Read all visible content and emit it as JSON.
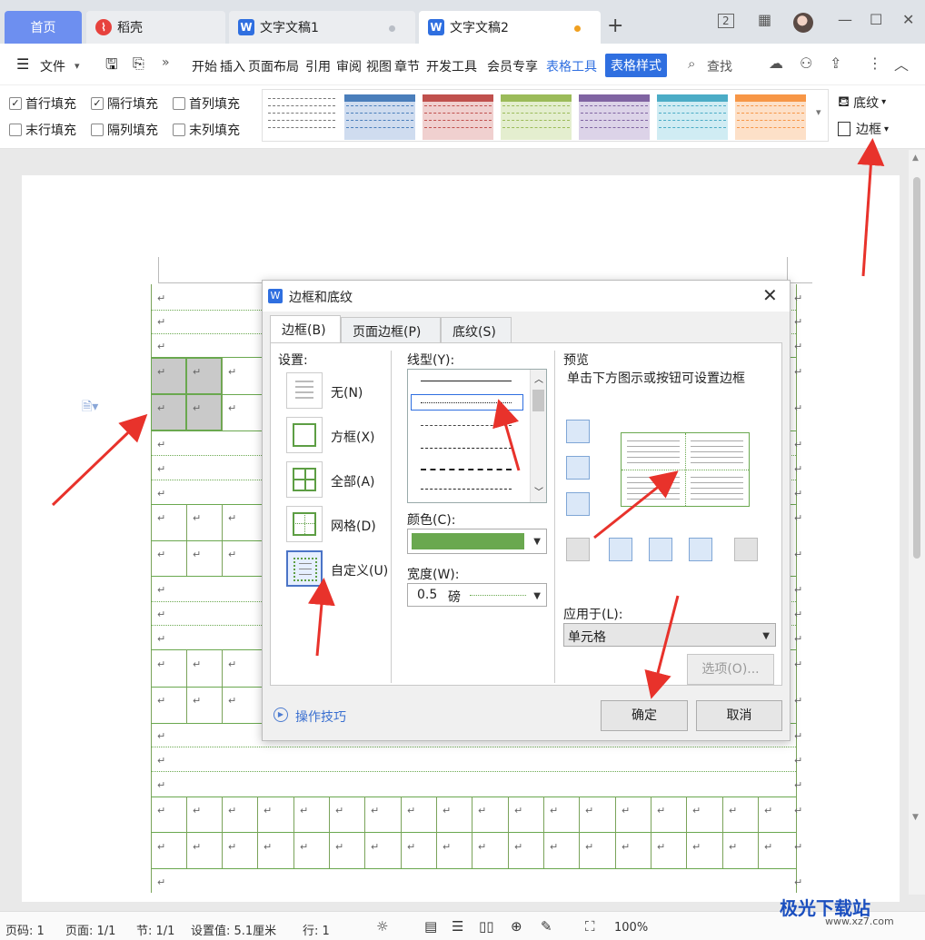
{
  "tabs": {
    "home": "首页",
    "daoke": "稻壳",
    "doc1": "文字文稿1",
    "doc2": "文字文稿2",
    "new_tab": "+"
  },
  "window_controls": {
    "layout_badge": "2",
    "minimize": "—",
    "maximize": "☐",
    "close": "✕"
  },
  "menu": {
    "file": "文件",
    "items": [
      "开始",
      "插入",
      "页面布局",
      "引用",
      "审阅",
      "视图",
      "章节",
      "开发工具",
      "会员专享"
    ],
    "table_tools": "表格工具",
    "table_style": "表格样式",
    "search": "查找"
  },
  "ribbon": {
    "checkboxes": [
      {
        "label": "首行填充",
        "checked": true
      },
      {
        "label": "隔行填充",
        "checked": true
      },
      {
        "label": "首列填充",
        "checked": false
      },
      {
        "label": "末行填充",
        "checked": false
      },
      {
        "label": "隔列填充",
        "checked": false
      },
      {
        "label": "末列填充",
        "checked": false
      }
    ],
    "style_colors": [
      "#999999",
      "#4a7ebb",
      "#c0504d",
      "#9bbb59",
      "#8064a2",
      "#4bacc6",
      "#f79646"
    ],
    "shading": "底纹",
    "border": "边框"
  },
  "dialog": {
    "title": "边框和底纹",
    "tabs": [
      "边框(B)",
      "页面边框(P)",
      "底纹(S)"
    ],
    "settings_label": "设置:",
    "settings": [
      "无(N)",
      "方框(X)",
      "全部(A)",
      "网格(D)",
      "自定义(U)"
    ],
    "selected_setting": "自定义(U)",
    "line_style_label": "线型(Y):",
    "color_label": "颜色(C):",
    "color_value": "#6aa84f",
    "width_label": "宽度(W):",
    "width_value": "0.5",
    "width_unit": "磅",
    "preview_label": "预览",
    "preview_hint": "单击下方图示或按钮可设置边框",
    "apply_label": "应用于(L):",
    "apply_value": "单元格",
    "options_button": "选项(O)...",
    "tips_link": "操作技巧",
    "ok_button": "确定",
    "cancel_button": "取消"
  },
  "status": {
    "page": "页码: 1",
    "pages": "页面: 1/1",
    "section": "节: 1/1",
    "position": "设置值: 5.1厘米",
    "line": "行: 1",
    "zoom": "100%"
  },
  "watermark": {
    "brand": "极光下载站",
    "url": "www.xz7.com"
  },
  "paragraph_mark": "↵"
}
